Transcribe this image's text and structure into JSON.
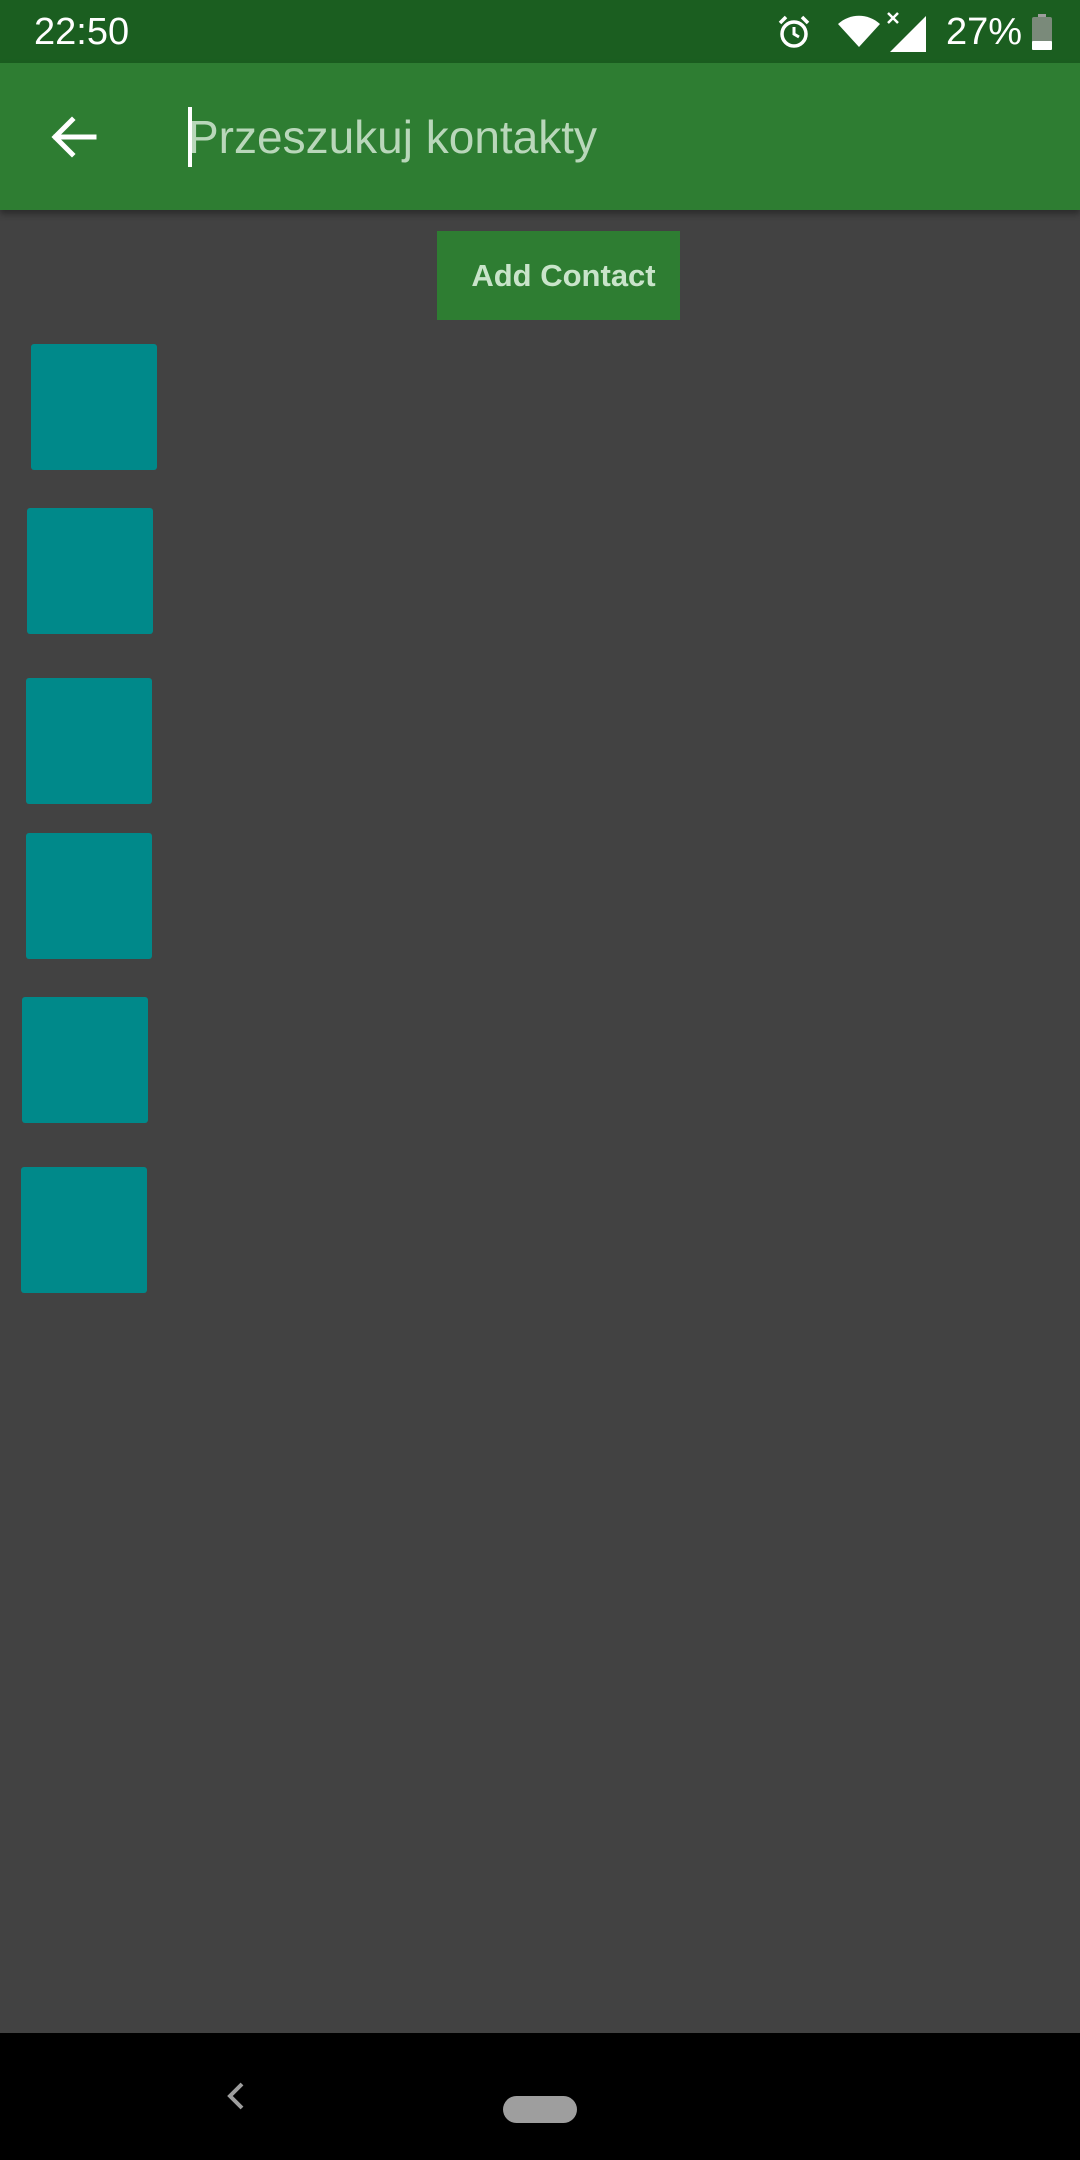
{
  "status_bar": {
    "time": "22:50",
    "battery_percent": "27%",
    "battery_level": 0.27,
    "icons": [
      "alarm-icon",
      "wifi-icon",
      "cell-signal-icon",
      "battery-icon"
    ]
  },
  "toolbar": {
    "back_icon": "arrow-left-icon",
    "search_placeholder": "Przeszukuj kontakty",
    "search_value": ""
  },
  "add_contact": {
    "label": "Add Contact"
  },
  "contacts": [
    {
      "tile_color": "#00898a"
    },
    {
      "tile_color": "#00898a"
    },
    {
      "tile_color": "#00898a"
    },
    {
      "tile_color": "#00898a"
    },
    {
      "tile_color": "#00898a"
    },
    {
      "tile_color": "#00898a"
    }
  ],
  "navigation_bar": {
    "back_icon": "chevron-left-icon",
    "home_icon": "home-pill-icon"
  },
  "colors": {
    "status_bar": "#1b5e20",
    "toolbar": "#2e7d32",
    "background": "#424242",
    "tile": "#00898a",
    "nav_bar": "#000000"
  }
}
